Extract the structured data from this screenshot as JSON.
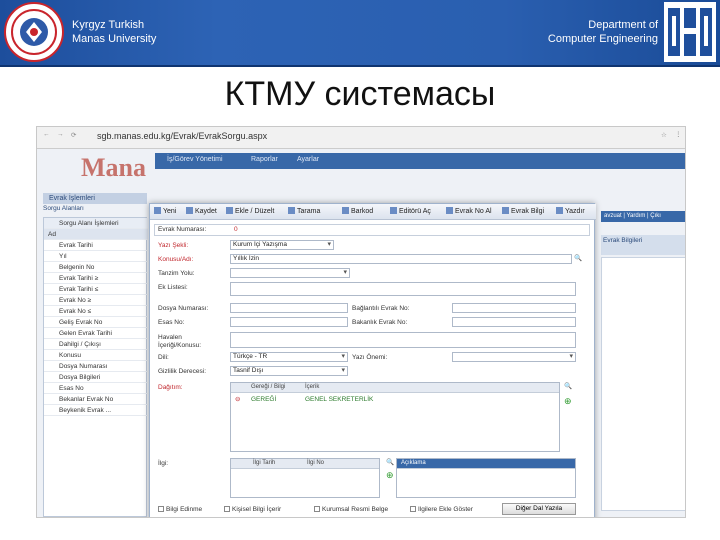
{
  "header": {
    "university_line1": "Kyrgyz Turkish",
    "university_line2": "Manas University",
    "dept_line1": "Department of",
    "dept_line2": "Computer Engineering",
    "slide_title": "КТМУ системасы"
  },
  "browser": {
    "url": "sgb.manas.edu.kg/Evrak/EvrakSorgu.aspx"
  },
  "site": {
    "brand": "Mana",
    "nav": [
      "İş/Görev Yönetimi",
      "Raporlar",
      "Ayarlar"
    ],
    "left_title": "Evrak İşlemleri",
    "left_sub": "Sorgu Alanları",
    "left_search": "Sorgu Alanı İşlemleri",
    "left_col": "Ad",
    "left_rows": [
      "Evrak Tarihi",
      "Yıl",
      "Belgenin No",
      "Evrak Tarihi ≥",
      "Evrak Tarihi ≤",
      "Evrak No ≥",
      "Evrak No ≤",
      "Geliş Evrak No",
      "Gelen Evrak Tarihi",
      "Dahilgi / Çıkışı",
      "Konusu",
      "Dosya Numarası",
      "Dosya Bilgileri",
      "Esas No",
      "Bekanlar Evrak No",
      "Beykenik Evrak ..."
    ],
    "right_tabs": "avzuat | Yardım | Çıkı",
    "right_title": "Evrak Bilgileri"
  },
  "toolbar": [
    "Yeni",
    "Kaydet",
    "Ekle / Düzelt",
    "Tarama",
    "Barkod",
    "Editörü Aç",
    "Evrak No Al",
    "Evrak Bilgi",
    "Yazdır"
  ],
  "form": {
    "evrak_no_label": "Evrak Numarası:",
    "evrak_no_value": "0",
    "yazi_sekli_label": "Yazı Şekli:",
    "yazi_sekli_value": "Kurum İçi Yazışma",
    "konusu_label": "Konusu/Adı:",
    "konusu_value": "Yıllık İzin",
    "tanzim_label": "Tanzim Yolu:",
    "ek_label": "Ek Listesi:",
    "dosya_label": "Dosya Numarası:",
    "esas_label": "Esas No:",
    "baglanti_label": "Bağlantılı Evrak No:",
    "bakanlik_label": "Bakanlık Evrak No:",
    "havale_label": "Havalen İçeriği/Konusu:",
    "dil_label": "Dili:",
    "dil_value": "Türkçe - TR",
    "yazi_label": "Yazı Önemi:",
    "gizlilik_label": "Gizlilik Derecesi:",
    "gizlilik_value": "Tasnif Dışı",
    "dagitim_label": "Dağıtım:",
    "dagitim_headers": [
      "Gereği / Bilgi",
      "İçerik"
    ],
    "dagitim_row": [
      "GEREĞİ",
      "GENEL SEKRETERLİK"
    ],
    "ilgi_label": "İlgi:",
    "ilgi_headers": [
      "İlgi Tarih",
      "İlgi No"
    ],
    "aciklama": "Açıklama",
    "checks": [
      "Bilgi Edinme",
      "Kişisel Bilgi İçerir",
      "Kurumsal Resmi Belge",
      "Ilgilere Ekle Göster"
    ],
    "bottom_button": "Diğer Dal Yazıla"
  },
  "colors": {
    "header": "#2a5fb0",
    "label_red": "#c1272d"
  }
}
